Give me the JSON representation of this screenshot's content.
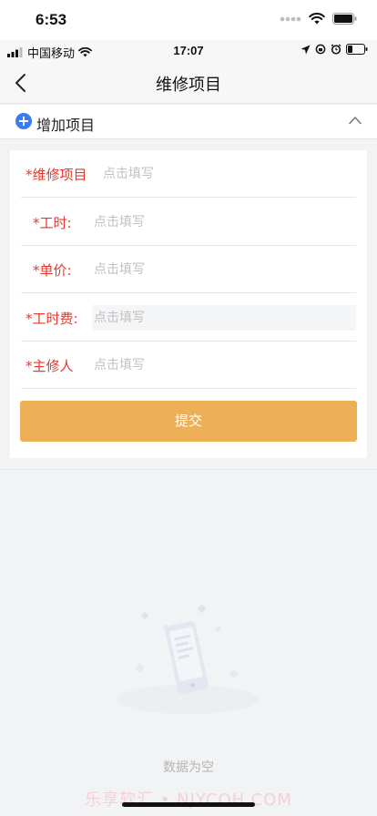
{
  "outer_status": {
    "time": "6:53"
  },
  "inner_status": {
    "carrier": "中国移动",
    "time": "17:07"
  },
  "nav": {
    "title": "维修项目",
    "back_icon": "chevron-left-icon"
  },
  "add_section": {
    "label": "增加项目",
    "plus_icon": "plus-circle-icon",
    "collapse_icon": "chevron-up-icon"
  },
  "form": {
    "fields": [
      {
        "label": "*维修项目",
        "placeholder": "点击填写"
      },
      {
        "label": "*工时:",
        "placeholder": "点击填写"
      },
      {
        "label": "*单价:",
        "placeholder": "点击填写"
      },
      {
        "label": "*工时费:",
        "placeholder": "点击填写"
      },
      {
        "label": "*主修人",
        "placeholder": "点击填写"
      }
    ],
    "submit_label": "提交"
  },
  "empty": {
    "text": "数据为空"
  },
  "watermark": "乐享软汇 • NJYCOH.COM",
  "colors": {
    "accent": "#eeb056",
    "required": "#e8382d",
    "plus": "#3a7bf4"
  }
}
